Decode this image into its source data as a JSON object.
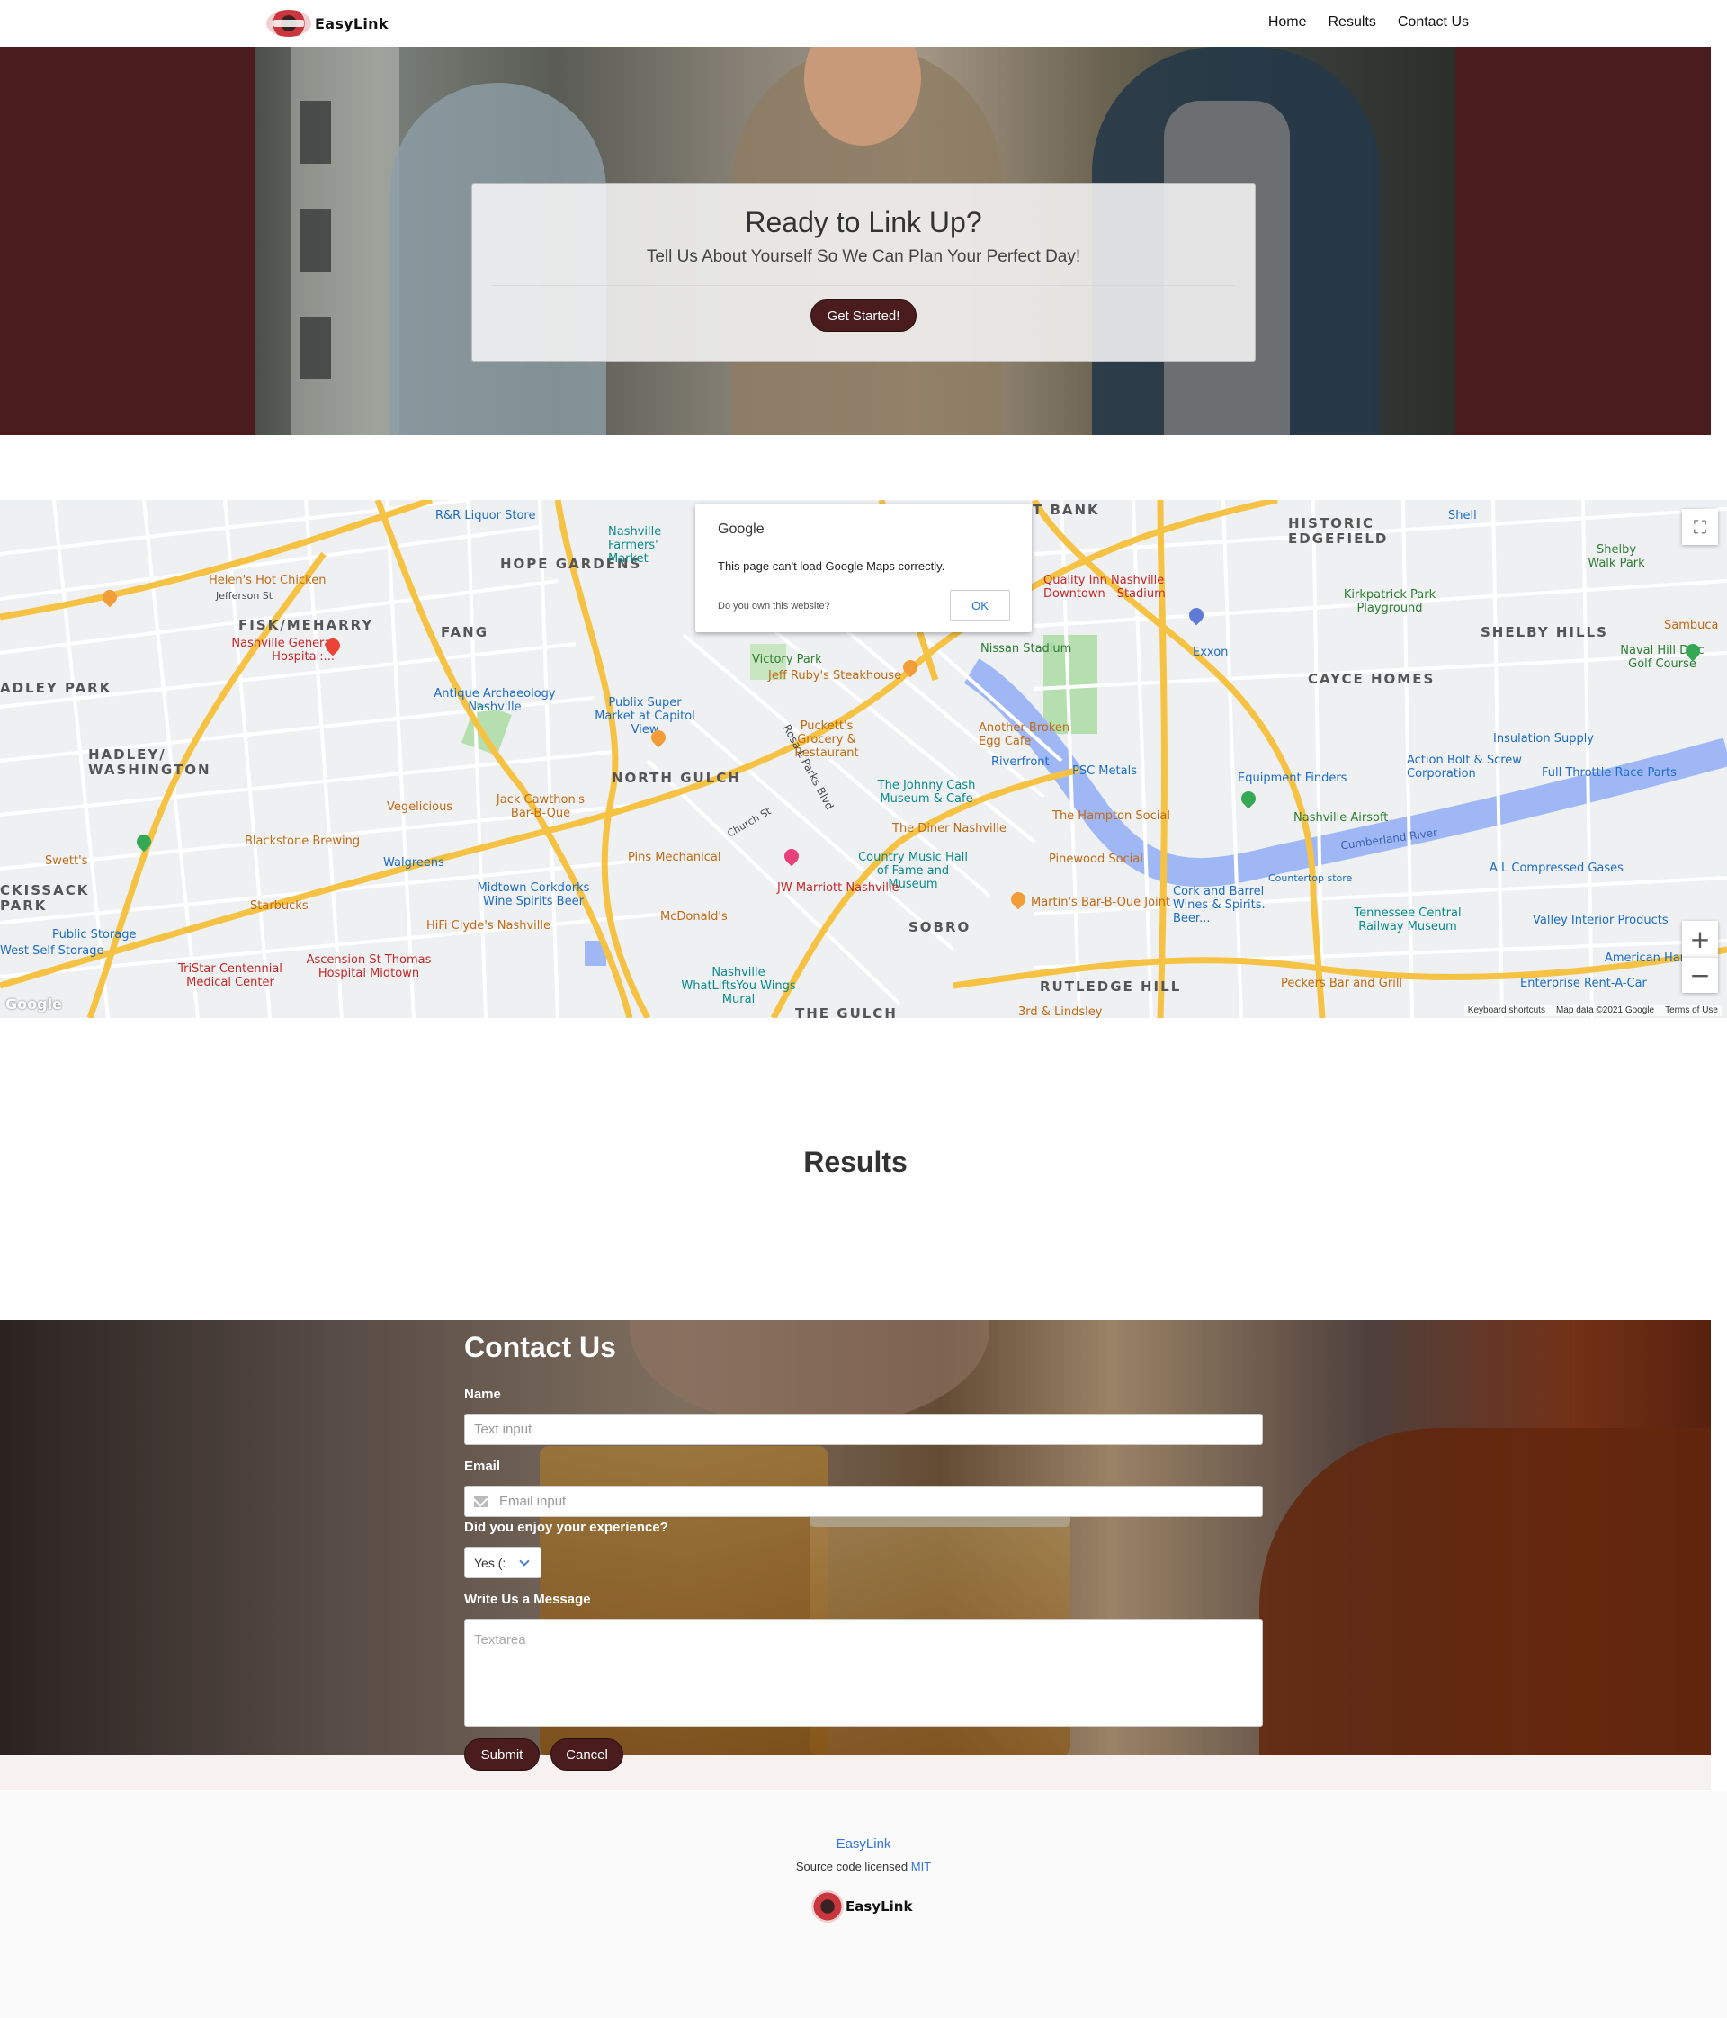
{
  "navbar": {
    "brand": "EasyLink",
    "links": [
      "Home",
      "Results",
      "Contact Us"
    ]
  },
  "hero": {
    "title": "Ready to Link Up?",
    "subtitle": "Tell Us About Yourself So We Can Plan Your Perfect Day!",
    "button": "Get Started!"
  },
  "map": {
    "dialog": {
      "brand": "Google",
      "message": "This page can't load Google Maps correctly.",
      "question": "Do you own this website?",
      "ok": "OK"
    },
    "neighborhoods": [
      "HOPE GARDENS",
      "FISK/MEHARRY",
      "FANG",
      "HADLEY/ WASHINGTON",
      "NORTH GULCH",
      "SOBRO",
      "RUTLEDGE HILL",
      "THE GULCH",
      "HISTORIC EDGEFIELD",
      "SHELBY HILLS",
      "CAYCE HOMES",
      "ADLEY PARK",
      "CKISSACK PARK",
      "T BANK"
    ],
    "places": [
      {
        "name": "R&R Liquor Store",
        "kind": "blue"
      },
      {
        "name": "Nashville Farmers' Market",
        "kind": "teal"
      },
      {
        "name": "Helen's Hot Chicken",
        "kind": "orange"
      },
      {
        "name": "Jefferson St",
        "kind": "road"
      },
      {
        "name": "Nashville General Hospital:...",
        "kind": "red"
      },
      {
        "name": "Antique Archaeology Nashville",
        "kind": "blue"
      },
      {
        "name": "Publix Super Market at Capitol View",
        "kind": "blue"
      },
      {
        "name": "Victory Park",
        "kind": "green"
      },
      {
        "name": "Jeff Ruby's Steakhouse",
        "kind": "orange"
      },
      {
        "name": "Quality Inn Nashville Downtown - Stadium",
        "kind": "pink"
      },
      {
        "name": "Nissan Stadium",
        "kind": "green"
      },
      {
        "name": "Exxon",
        "kind": "blue"
      },
      {
        "name": "Kirkpatrick Park Playground",
        "kind": "green"
      },
      {
        "name": "Shell",
        "kind": "blue"
      },
      {
        "name": "Shelby Walk Park",
        "kind": "green"
      },
      {
        "name": "Sambuca",
        "kind": "orange"
      },
      {
        "name": "Naval Hill Disc Golf Course",
        "kind": "green"
      },
      {
        "name": "Puckett's Grocery & Restaurant",
        "kind": "orange"
      },
      {
        "name": "Another Broken Egg Cafe",
        "kind": "orange"
      },
      {
        "name": "Riverfront",
        "kind": "blue"
      },
      {
        "name": "PSC Metals",
        "kind": "blue"
      },
      {
        "name": "Action Bolt & Screw Corporation",
        "kind": "blue"
      },
      {
        "name": "Insulation Supply",
        "kind": "blue"
      },
      {
        "name": "Full Throttle Race Parts",
        "kind": "blue"
      },
      {
        "name": "Equipment Finders",
        "kind": "blue"
      },
      {
        "name": "Nashville Airsoft",
        "kind": "green"
      },
      {
        "name": "Vegelicious",
        "kind": "orange"
      },
      {
        "name": "Jack Cawthon's Bar-B-Que",
        "kind": "orange"
      },
      {
        "name": "The Johnny Cash Museum & Cafe",
        "kind": "teal"
      },
      {
        "name": "The Diner Nashville",
        "kind": "orange"
      },
      {
        "name": "The Hampton Social",
        "kind": "orange"
      },
      {
        "name": "Cumberland River",
        "kind": "water"
      },
      {
        "name": "Blackstone Brewing",
        "kind": "orange"
      },
      {
        "name": "Walgreens",
        "kind": "blue"
      },
      {
        "name": "Pins Mechanical",
        "kind": "orange"
      },
      {
        "name": "Country Music Hall of Fame and Museum",
        "kind": "teal"
      },
      {
        "name": "Pinewood Social",
        "kind": "orange"
      },
      {
        "name": "A L Compressed Gases",
        "kind": "blue"
      },
      {
        "name": "Swett's",
        "kind": "orange"
      },
      {
        "name": "Midtown Corkdorks Wine Spirits Beer",
        "kind": "blue"
      },
      {
        "name": "JW Marriott Nashville",
        "kind": "pink"
      },
      {
        "name": "Cork and Barrel Wines & Spirits. Beer...",
        "kind": "blue"
      },
      {
        "name": "Tennessee Central Railway Museum",
        "kind": "teal"
      },
      {
        "name": "Valley Interior Products",
        "kind": "blue"
      },
      {
        "name": "Starbucks",
        "kind": "orange"
      },
      {
        "name": "HiFi Clyde's Nashville",
        "kind": "orange"
      },
      {
        "name": "McDonald's",
        "kind": "orange"
      },
      {
        "name": "Martin's Bar-B-Que Joint",
        "kind": "orange"
      },
      {
        "name": "Public Storage",
        "kind": "blue"
      },
      {
        "name": "American Har",
        "kind": "blue"
      },
      {
        "name": "West Self Storage",
        "kind": "blue"
      },
      {
        "name": "TriStar Centennial Medical Center",
        "kind": "red"
      },
      {
        "name": "Ascension St Thomas Hospital Midtown",
        "kind": "red"
      },
      {
        "name": "Nashville WhatLiftsYou Wings Mural",
        "kind": "teal"
      },
      {
        "name": "Peckers Bar and Grill",
        "kind": "orange"
      },
      {
        "name": "Enterprise Rent-A-Car",
        "kind": "blue"
      },
      {
        "name": "3rd & Lindsley",
        "kind": "orange"
      },
      {
        "name": "Countertop store",
        "kind": "blue"
      },
      {
        "name": "Church St",
        "kind": "road"
      },
      {
        "name": "Rosa L Parks Blvd",
        "kind": "road"
      }
    ],
    "footer": {
      "logo": "Google",
      "shortcuts": "Keyboard shortcuts",
      "data": "Map data ©2021 Google",
      "terms": "Terms of Use"
    },
    "controls": {
      "fullscreen": "⛶",
      "zoom_in": "+",
      "zoom_out": "−"
    }
  },
  "results": {
    "title": "Results"
  },
  "contact": {
    "title": "Contact Us",
    "name_label": "Name",
    "name_placeholder": "Text input",
    "email_label": "Email",
    "email_placeholder": "Email input",
    "experience_label": "Did you enjoy your experience?",
    "experience_value": "Yes (:",
    "message_label": "Write Us a Message",
    "message_placeholder": "Textarea",
    "submit": "Submit",
    "cancel": "Cancel"
  },
  "footer": {
    "name": "EasyLink",
    "license_prefix": "Source code licensed",
    "license_link": "MIT",
    "brand": "EasyLink"
  },
  "colors": {
    "brand_dark": "#4a1c1e",
    "link_blue": "#3273dc",
    "map_road": "#f6c244",
    "map_water": "#9fb8f5",
    "map_park": "#b6dfb0"
  }
}
